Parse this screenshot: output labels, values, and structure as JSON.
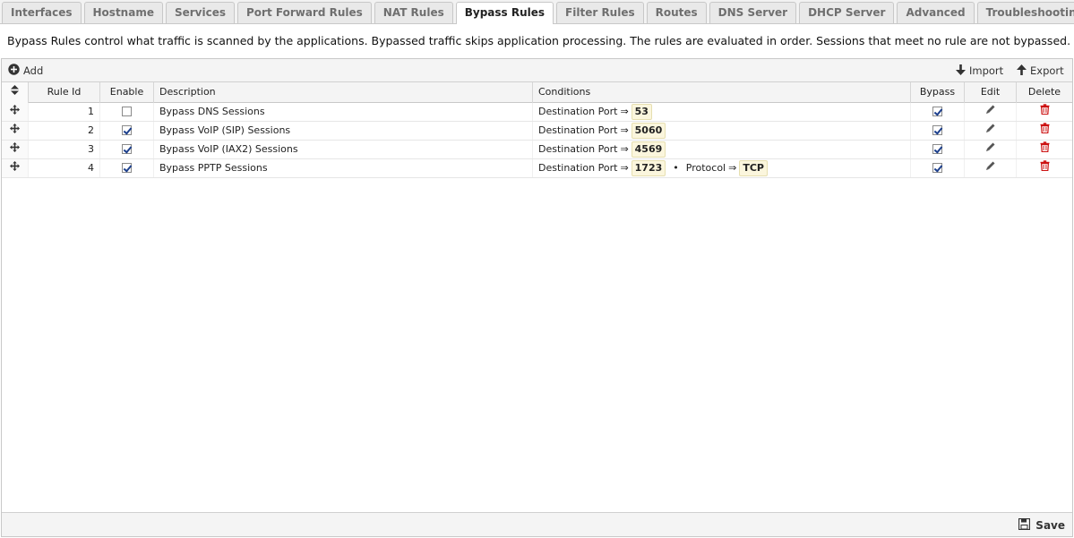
{
  "tabs": [
    {
      "label": "Interfaces",
      "active": false
    },
    {
      "label": "Hostname",
      "active": false
    },
    {
      "label": "Services",
      "active": false
    },
    {
      "label": "Port Forward Rules",
      "active": false
    },
    {
      "label": "NAT Rules",
      "active": false
    },
    {
      "label": "Bypass Rules",
      "active": true
    },
    {
      "label": "Filter Rules",
      "active": false
    },
    {
      "label": "Routes",
      "active": false
    },
    {
      "label": "DNS Server",
      "active": false
    },
    {
      "label": "DHCP Server",
      "active": false
    },
    {
      "label": "Advanced",
      "active": false
    },
    {
      "label": "Troubleshooting",
      "active": false
    }
  ],
  "description": "Bypass Rules control what traffic is scanned by the applications. Bypassed traffic skips application processing. The rules are evaluated in order. Sessions that meet no rule are not bypassed.",
  "toolbar": {
    "add_label": "Add",
    "import_label": "Import",
    "export_label": "Export"
  },
  "columns": {
    "rule_id": "Rule Id",
    "enable": "Enable",
    "description": "Description",
    "conditions": "Conditions",
    "bypass": "Bypass",
    "edit": "Edit",
    "delete": "Delete"
  },
  "rows": [
    {
      "id": "1",
      "enabled": false,
      "description": "Bypass DNS Sessions",
      "conditions": [
        {
          "name": "Destination Port",
          "value": "53"
        }
      ],
      "bypass": true
    },
    {
      "id": "2",
      "enabled": true,
      "description": "Bypass VoIP (SIP) Sessions",
      "conditions": [
        {
          "name": "Destination Port",
          "value": "5060"
        }
      ],
      "bypass": true
    },
    {
      "id": "3",
      "enabled": true,
      "description": "Bypass VoIP (IAX2) Sessions",
      "conditions": [
        {
          "name": "Destination Port",
          "value": "4569"
        }
      ],
      "bypass": true
    },
    {
      "id": "4",
      "enabled": true,
      "description": "Bypass PPTP Sessions",
      "conditions": [
        {
          "name": "Destination Port",
          "value": "1723"
        },
        {
          "name": "Protocol",
          "value": "TCP"
        }
      ],
      "bypass": true
    }
  ],
  "footer": {
    "save_label": "Save"
  },
  "colors": {
    "delete_icon": "#cc1111",
    "checkmark": "#1c3f8c",
    "value_bg": "#fbf6dd"
  },
  "icons": {
    "add": "plus-circle-icon",
    "import": "arrow-down-icon",
    "export": "arrow-up-icon",
    "drag": "move-icon",
    "edit": "pencil-icon",
    "delete": "trash-icon",
    "save": "floppy-icon"
  }
}
